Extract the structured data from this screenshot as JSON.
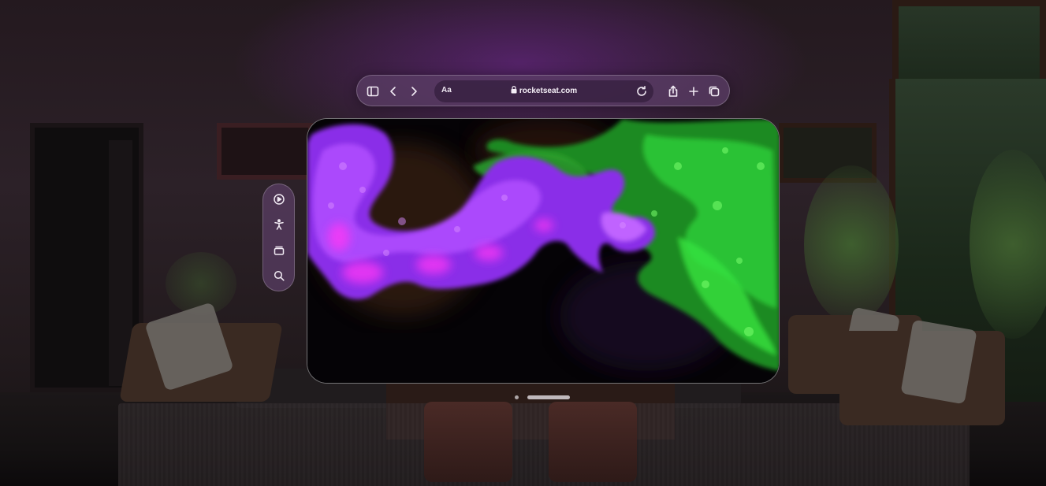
{
  "browser": {
    "address_bar": {
      "reader_label": "Aa",
      "url": "rocketseat.com"
    },
    "toolbar_icons": [
      "sidebar-icon",
      "back-icon",
      "forward-icon",
      "lock-icon",
      "reload-icon",
      "share-icon",
      "plus-icon",
      "tabs-icon"
    ]
  },
  "ornament": {
    "icons": [
      "play-circle-icon",
      "accessibility-icon",
      "window-stack-icon",
      "search-icon"
    ]
  },
  "content": {
    "description_icon": "fluid-simulation-art",
    "colors": {
      "purple": "#9b3cff",
      "magenta": "#e040ff",
      "green": "#2fd03a",
      "background": "#050306"
    }
  }
}
